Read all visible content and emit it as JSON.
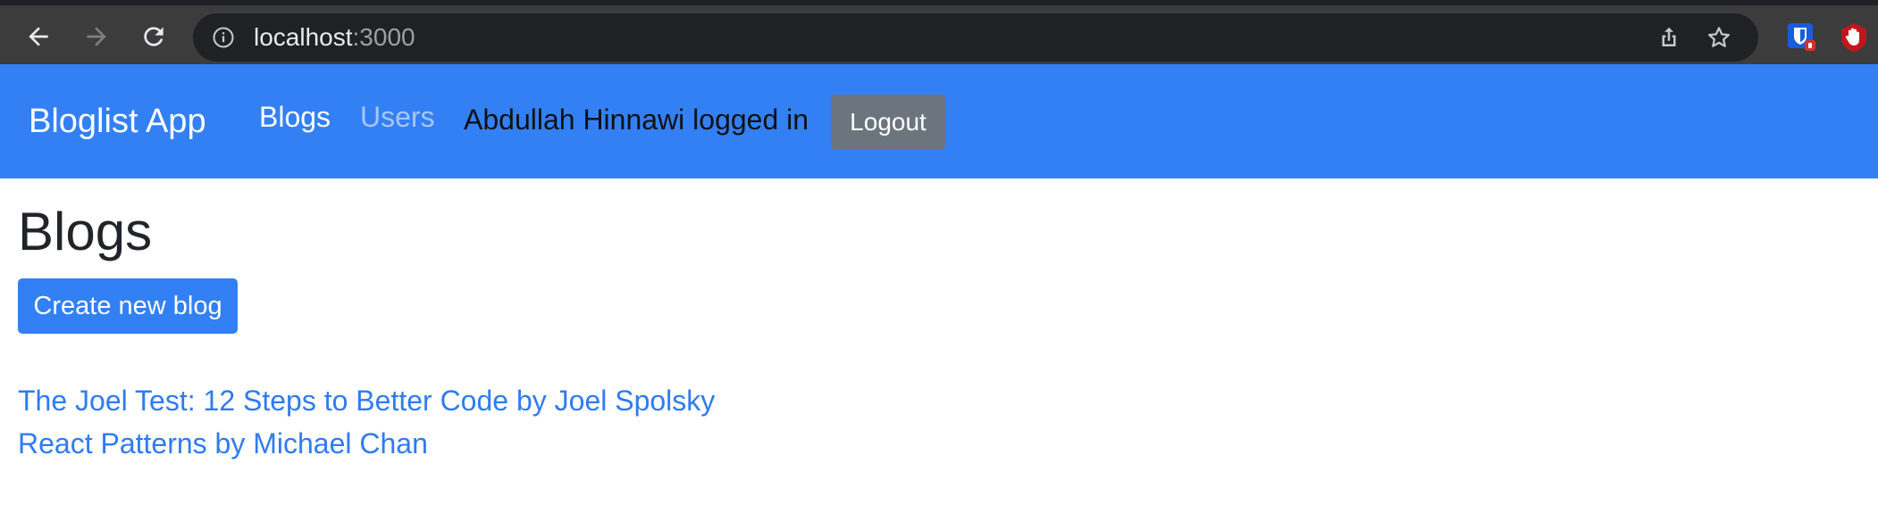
{
  "browser": {
    "url_host": "localhost",
    "url_port": ":3000",
    "icons": {
      "back": "arrow-left-icon",
      "forward": "arrow-right-icon",
      "reload": "reload-icon",
      "site_info": "info-icon",
      "share": "share-icon",
      "bookmark": "star-icon",
      "ext_bitwarden": "bitwarden-extension-icon",
      "ext_ublock": "ublock-extension-icon"
    },
    "colors": {
      "toolbar": "#3c3c3c",
      "omnibox": "#202124"
    }
  },
  "navbar": {
    "brand": "Bloglist App",
    "links": [
      {
        "label": "Blogs",
        "active": true
      },
      {
        "label": "Users",
        "active": false
      }
    ],
    "logged_in_text": "Abdullah Hinnawi logged in",
    "logout_label": "Logout",
    "color": "#3380f4"
  },
  "main": {
    "title": "Blogs",
    "create_button_label": "Create new blog",
    "blogs": [
      {
        "label": "The Joel Test: 12 Steps to Better Code by Joel Spolsky"
      },
      {
        "label": "React Patterns by Michael Chan"
      }
    ],
    "link_color": "#2f7bf0"
  }
}
